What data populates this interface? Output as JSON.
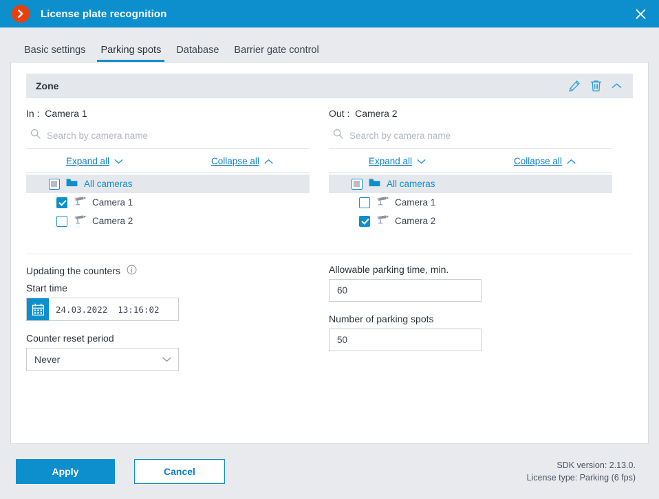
{
  "window": {
    "title": "License plate recognition",
    "logo_icon": "chevron-right-circle-icon",
    "close_icon": "close-icon"
  },
  "tabs": [
    {
      "label": "Basic settings",
      "active": false
    },
    {
      "label": "Parking spots",
      "active": true
    },
    {
      "label": "Database",
      "active": false
    },
    {
      "label": "Barrier gate control",
      "active": false
    }
  ],
  "zone": {
    "title": "Zone",
    "edit_icon": "pencil-icon",
    "delete_icon": "trash-icon",
    "collapse_icon": "chevron-up-icon"
  },
  "panels": {
    "in": {
      "label": "In :  Camera 1",
      "search_placeholder": "Search by camera name",
      "search_value": "",
      "search_icon": "search-icon",
      "expand_all": "Expand all",
      "collapse_all": "Collapse all",
      "tree": [
        {
          "label": "All cameras",
          "state": "indeterminate",
          "icon": "folder-icon",
          "level": 0
        },
        {
          "label": "Camera 1",
          "state": "checked",
          "icon": "camera-icon",
          "level": 1
        },
        {
          "label": "Camera 2",
          "state": "unchecked",
          "icon": "camera-icon",
          "level": 1
        }
      ]
    },
    "out": {
      "label": "Out :  Camera 2",
      "search_placeholder": "Search by camera name",
      "search_value": "",
      "search_icon": "search-icon",
      "expand_all": "Expand all",
      "collapse_all": "Collapse all",
      "tree": [
        {
          "label": "All cameras",
          "state": "indeterminate",
          "icon": "folder-icon",
          "level": 0
        },
        {
          "label": "Camera 1",
          "state": "unchecked",
          "icon": "camera-icon",
          "level": 1
        },
        {
          "label": "Camera 2",
          "state": "checked",
          "icon": "camera-icon",
          "level": 1
        }
      ]
    }
  },
  "form": {
    "counters_heading": "Updating the counters",
    "info_icon": "info-icon",
    "start_time_label": "Start time",
    "start_time_value": "24.03.2022  13:16:02",
    "calendar_icon": "calendar-icon",
    "reset_period_label": "Counter reset period",
    "reset_period_value": "Never",
    "reset_period_options": [
      "Never"
    ],
    "dropdown_icon": "chevron-down-icon",
    "parking_time_label": "Allowable parking time, min.",
    "parking_time_value": "60",
    "parking_spots_label": "Number of parking spots",
    "parking_spots_value": "50"
  },
  "footer": {
    "apply_label": "Apply",
    "cancel_label": "Cancel",
    "sdk_version": "SDK version: 2.13.0.",
    "license_type": "License type: Parking (6 fps)"
  },
  "colors": {
    "accent": "#0d8ecd",
    "logo": "#e8400c",
    "chrome": "#e8eaed",
    "zone_header": "#e4e7ec",
    "text": "#2b323d"
  }
}
